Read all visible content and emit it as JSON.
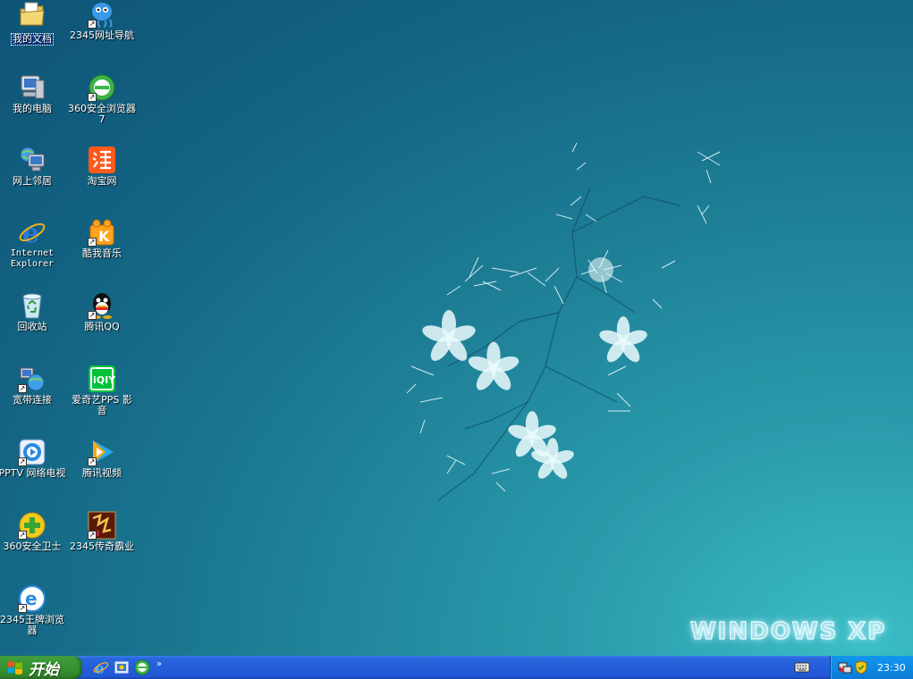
{
  "desktop": {
    "icons": [
      {
        "label": "我的文档",
        "icon": "my-documents-icon"
      },
      {
        "label": "我的电脑",
        "icon": "my-computer-icon"
      },
      {
        "label": "网上邻居",
        "icon": "network-places-icon"
      },
      {
        "label": "Internet Explorer",
        "icon": "internet-explorer-icon"
      },
      {
        "label": "回收站",
        "icon": "recycle-bin-icon"
      },
      {
        "label": "宽带连接",
        "icon": "broadband-connection-icon"
      },
      {
        "label": "PPTV 网络电视",
        "icon": "pptv-icon"
      },
      {
        "label": "360安全卫士",
        "icon": "360-safe-guard-icon"
      },
      {
        "label": "2345王牌浏览器",
        "icon": "2345-browser-icon"
      },
      {
        "label": "2345网址导航",
        "icon": "2345-nav-icon"
      },
      {
        "label": "360安全浏览器7",
        "icon": "360-browser-icon"
      },
      {
        "label": "淘宝网",
        "icon": "taobao-icon"
      },
      {
        "label": "酷我音乐",
        "icon": "kuwo-music-icon"
      },
      {
        "label": "腾讯QQ",
        "icon": "qq-icon"
      },
      {
        "label": "爱奇艺PPS 影音",
        "icon": "iqiyi-icon"
      },
      {
        "label": "腾讯视频",
        "icon": "tencent-video-icon"
      },
      {
        "label": "2345传奇霸业",
        "icon": "legend-game-icon"
      }
    ],
    "wallpaper_logo": "WINDOWS XP"
  },
  "taskbar": {
    "start_label": "开始",
    "quick_launch": [
      "internet-explorer-icon",
      "show-desktop-icon",
      "360-browser-icon"
    ],
    "overflow": "»",
    "clock": "23:30"
  },
  "colors": {
    "taskbar_blue": "#245ddb",
    "start_green": "#3c9a3a",
    "tray_blue": "#0d8ae6",
    "wallpaper_teal": "#1d7d95"
  }
}
